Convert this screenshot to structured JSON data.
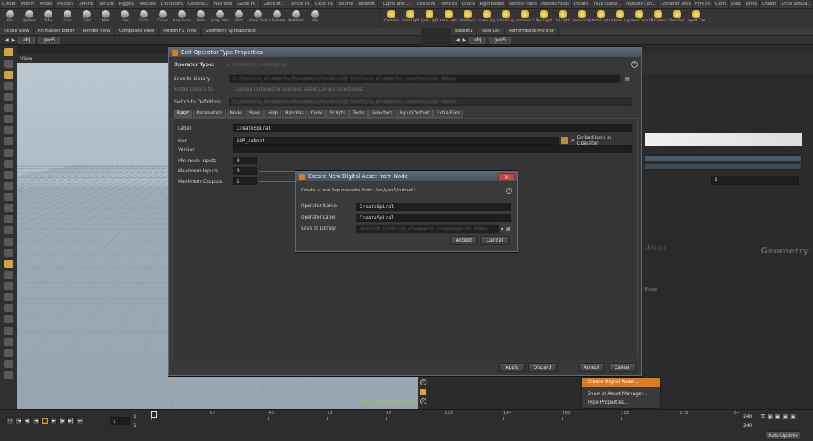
{
  "shelf_tabs_left": [
    "Create",
    "Modify",
    "Model",
    "Polygon",
    "Deform",
    "Texture",
    "Rigging",
    "Muscles",
    "Characters",
    "Constrai...",
    "Hair Utils",
    "Guide Pr...",
    "Guide Br...",
    "Terrain FX",
    "Cloud FX",
    "Volume",
    "Redshift"
  ],
  "shelf_tabs_right": [
    "Lights and C...",
    "Collisions",
    "Particles",
    "Grains",
    "Rigid Bodies",
    "Particle Fluids",
    "Viscous Fluids",
    "Oceans",
    "Fluid Contai...",
    "Populate Con...",
    "Container Tools",
    "Pyro FX",
    "Cloth",
    "Solid",
    "Wires",
    "Crowds",
    "Drive Simula..."
  ],
  "tools_left": [
    "Box",
    "Sphere",
    "Tube",
    "Torus",
    "Grid",
    "Null",
    "Line",
    "Circle",
    "Curve",
    "Draw Curve",
    "Path",
    "Spray Paint",
    "Font",
    "Platonic Solids",
    "L-System",
    "Metaball",
    "File"
  ],
  "tools_right": [
    "Camera",
    "Point Light",
    "Spot Light",
    "Area Light",
    "Geometry Light",
    "Volume Light",
    "Distant Light",
    "Environment Light",
    "Sky Light",
    "GI Light",
    "Caustic Light",
    "Portal Light",
    "Ambient Light",
    "Stereo Camera",
    "VR Camera",
    "Switcher",
    "Gamepad Camera"
  ],
  "left_pane_tabs": [
    "Scene View",
    "Animation Editor",
    "Render View",
    "Composite View",
    "Motion FX View",
    "Geometry Spreadsheet"
  ],
  "right_pane_tabs": [
    "subnet1",
    "Take List",
    "Performance Monitor"
  ],
  "path_left": {
    "obj": "obj",
    "geo": "geo5"
  },
  "path_right": {
    "obj": "obj",
    "geo": "geo5"
  },
  "view_label": "View",
  "right_labels": {
    "edition": "dition",
    "geometry": "Geometry",
    "enter": "r Enter",
    "one": "1"
  },
  "edit_dialog": {
    "title": "Edit Operator Type Properties",
    "operator_type_label": "Operator Type:",
    "operator_type_value": "a_elvemartu_createspiral",
    "save_to_library_label": "Save to Library",
    "save_to_library_value": "C:/Users/a_elvemartu/Documents/houdini18.5/otls/a_elvemartu_createspiral.hdanc",
    "install_library_label": "Install Library to",
    "install_library_value": "Library installed to Scanned Asset Library Directories",
    "switch_def_label": "Switch to Definition",
    "switch_def_value": "C:/Users/a_elvemartu/Documents/houdini18.5/otls/a_elvemartu_createspiral.hdanc",
    "tabs": [
      "Basic",
      "Parameters",
      "Node",
      "Save",
      "Help",
      "Handles",
      "Code",
      "Scripts",
      "Tools",
      "Selectors",
      "Input/Output",
      "Extra Files"
    ],
    "label_label": "Label",
    "label_value": "CreateSpiral",
    "icon_label": "Icon",
    "icon_value": "SOP_subnet",
    "embed_icon": "Embed Icon in Operator",
    "version_label": "Version",
    "min_inputs_label": "Minimum Inputs",
    "min_inputs_value": "0",
    "max_inputs_label": "Maximum Inputs",
    "max_inputs_value": "0",
    "max_outputs_label": "Maximum Outputs",
    "max_outputs_value": "1",
    "apply": "Apply",
    "discard": "Discard",
    "accept": "Accept",
    "cancel": "Cancel"
  },
  "create_dialog": {
    "title": "Create New Digital Asset from Node",
    "desc": "Create a new Sop operator from: /obj/geo5/subnet1",
    "op_name_label": "Operator Name",
    "op_name_value": "CreateSpiral",
    "op_label_label": "Operator Label",
    "op_label_value": "CreateSpiral",
    "save_lib_label": "Save to Library",
    "save_lib_value": "uhini18.5/otls/a_elvemartu_createspiral.hdanc",
    "accept": "Accept",
    "cancel": "Cancel"
  },
  "context_menu": [
    "Create Digital Asset...",
    "Show in Asset Manager...",
    "Type Properties..."
  ],
  "watermark": "Non-Commercial Edition",
  "timeline": {
    "current_frame": "1",
    "start": "1",
    "start2": "1",
    "ticks": [
      "1",
      "24",
      "48",
      "72",
      "96",
      "120",
      "144",
      "168",
      "192",
      "216",
      "24"
    ],
    "end": "240",
    "end2": "240",
    "auto_update": "Auto Update"
  }
}
